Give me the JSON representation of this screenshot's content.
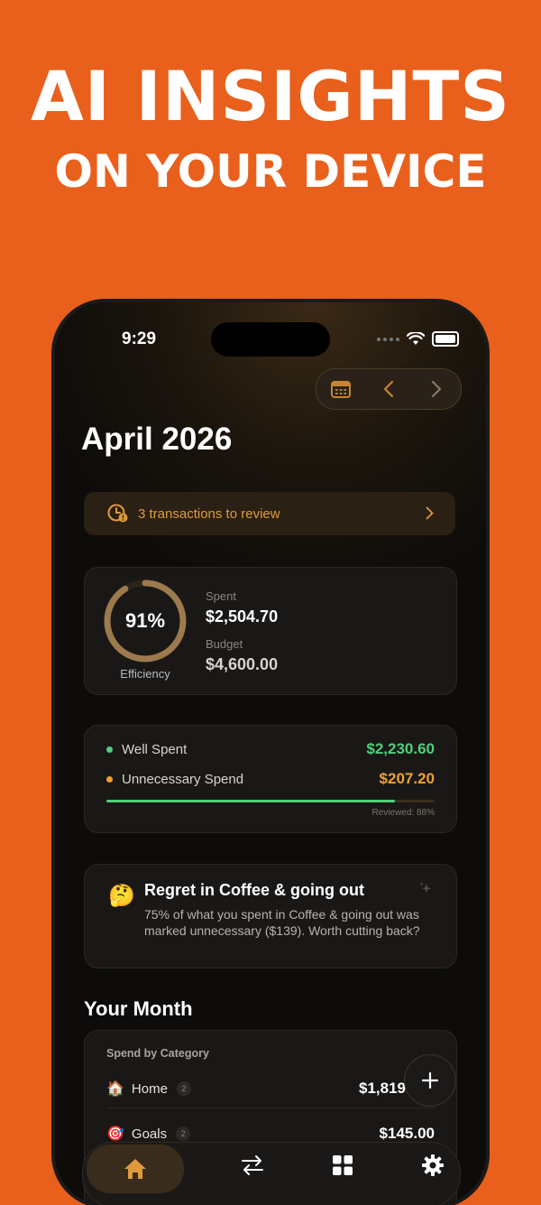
{
  "hero": {
    "line1": "AI INSIGHTS",
    "line2": "ON YOUR DEVICE"
  },
  "status_bar": {
    "time": "9:29"
  },
  "header": {
    "month_title": "April 2026"
  },
  "review_banner": {
    "text": "3 transactions to review"
  },
  "efficiency": {
    "percent_text": "91%",
    "percent": 91,
    "label": "Efficiency",
    "spent_label": "Spent",
    "spent_value": "$2,504.70",
    "budget_label": "Budget",
    "budget_value": "$4,600.00"
  },
  "spending": {
    "well_spent_label": "Well Spent",
    "well_spent_value": "$2,230.60",
    "unnecessary_label": "Unnecessary Spend",
    "unnecessary_value": "$207.20",
    "reviewed_text": "Reviewed: 88%",
    "reviewed_percent": 88
  },
  "insight": {
    "emoji": "🤔",
    "title": "Regret in Coffee & going out",
    "body": "75% of what you spent in Coffee & going out was marked unnecessary ($139). Worth cutting back?"
  },
  "your_month": {
    "title": "Your Month",
    "category_heading": "Spend by Category",
    "categories": [
      {
        "emoji": "🏠",
        "name": "Home",
        "count": "2",
        "amount": "$1,819"
      },
      {
        "emoji": "🎯",
        "name": "Goals",
        "count": "2",
        "amount": "$145.00"
      }
    ]
  },
  "colors": {
    "background": "#E8601C",
    "accent": "#E09A3C",
    "well_spent": "#4fd07a",
    "unnecessary": "#F0A030",
    "ring": "#9C7A4E"
  },
  "tabs": [
    {
      "name": "home-icon"
    },
    {
      "name": "transfer-arrows-icon"
    },
    {
      "name": "grid-icon"
    },
    {
      "name": "gear-icon"
    }
  ]
}
